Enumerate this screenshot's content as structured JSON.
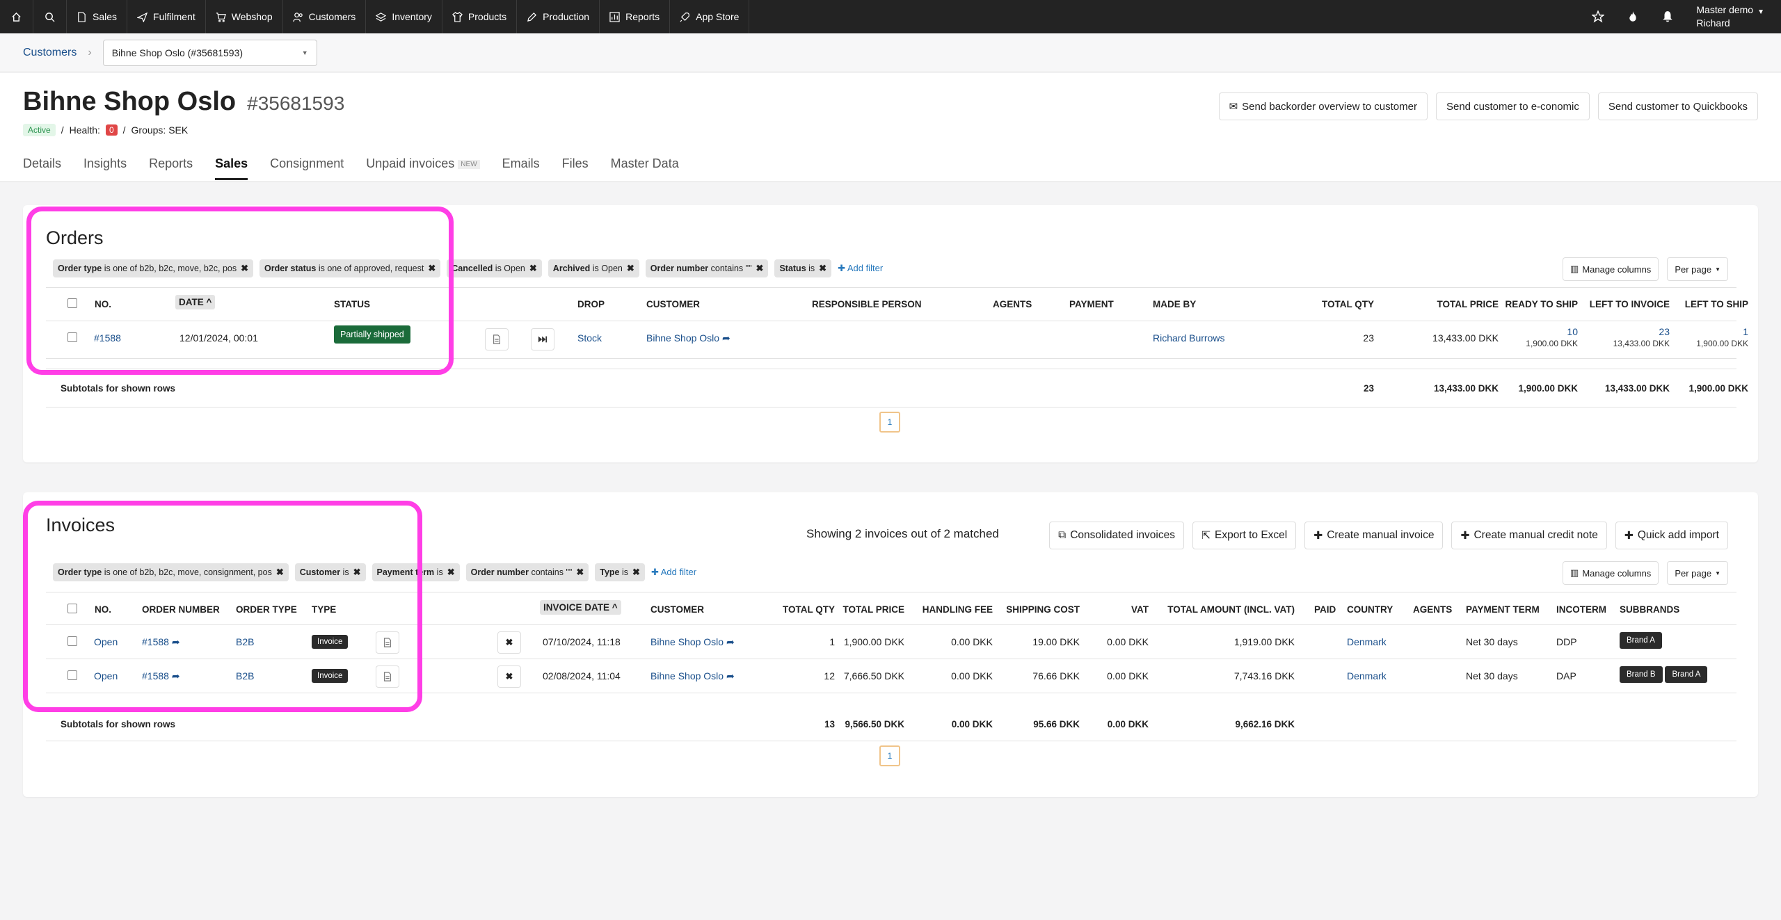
{
  "topnav": {
    "items": [
      "Sales",
      "Fulfilment",
      "Webshop",
      "Customers",
      "Inventory",
      "Products",
      "Production",
      "Reports",
      "App Store"
    ],
    "user_line1": "Master demo",
    "user_line2": "Richard"
  },
  "breadcrumb": {
    "root": "Customers",
    "selected": "Bihne Shop Oslo (#35681593)"
  },
  "customer": {
    "name": "Bihne Shop Oslo",
    "number": "#35681593",
    "status": "Active",
    "health_label": "Health:",
    "health_value": "0",
    "groups": "Groups: SEK"
  },
  "header_buttons": [
    "Send backorder overview to customer",
    "Send customer to e-conomic",
    "Send customer to Quickbooks"
  ],
  "tabs": [
    "Details",
    "Insights",
    "Reports",
    "Sales",
    "Consignment",
    "Unpaid invoices",
    "Emails",
    "Files",
    "Master Data"
  ],
  "tab_new_badge": "NEW",
  "orders": {
    "title": "Orders",
    "filters": [
      {
        "field": "Order type",
        "cond": "is one of b2b, b2c, move, b2c, pos"
      },
      {
        "field": "Order status",
        "cond": "is one of approved, request"
      },
      {
        "field": "Cancelled",
        "cond": "is Open"
      },
      {
        "field": "Archived",
        "cond": "is Open"
      },
      {
        "field": "Order number",
        "cond": "contains \"\""
      },
      {
        "field": "Status",
        "cond": "is"
      }
    ],
    "add_filter": "Add filter",
    "manage_columns": "Manage columns",
    "per_page": "Per page",
    "columns": [
      "NO.",
      "DATE",
      "STATUS",
      "DROP",
      "CUSTOMER",
      "RESPONSIBLE PERSON",
      "AGENTS",
      "PAYMENT",
      "MADE BY",
      "TOTAL QTY",
      "TOTAL PRICE",
      "READY TO SHIP",
      "LEFT TO INVOICE",
      "LEFT TO SHIP"
    ],
    "row": {
      "no": "#1588",
      "date": "12/01/2024, 00:01",
      "status": "Partially shipped",
      "drop": "Stock",
      "customer": "Bihne Shop Oslo",
      "made_by": "Richard Burrows",
      "total_qty": "23",
      "total_price": "13,433.00 DKK",
      "ready_to_ship": "10",
      "ready_to_ship_sub": "1,900.00 DKK",
      "left_to_invoice": "23",
      "left_to_invoice_sub": "13,433.00 DKK",
      "left_to_ship": "1",
      "left_to_ship_sub": "1,900.00 DKK"
    },
    "subtotal_label": "Subtotals for shown rows",
    "subtotals": {
      "qty": "23",
      "price": "13,433.00 DKK",
      "ready": "1,900.00 DKK",
      "left_inv": "13,433.00 DKK",
      "left_ship": "1,900.00 DKK"
    },
    "page": "1"
  },
  "invoices": {
    "title": "Invoices",
    "showing": "Showing 2 invoices out of 2 matched",
    "actions": [
      "Consolidated invoices",
      "Export to Excel",
      "Create manual invoice",
      "Create manual credit note",
      "Quick add import"
    ],
    "filters": [
      {
        "field": "Order type",
        "cond": "is one of b2b, b2c, move, consignment, pos"
      },
      {
        "field": "Customer",
        "cond": "is"
      },
      {
        "field": "Payment term",
        "cond": "is"
      },
      {
        "field": "Order number",
        "cond": "contains \"\""
      },
      {
        "field": "Type",
        "cond": "is"
      }
    ],
    "add_filter": "Add filter",
    "manage_columns": "Manage columns",
    "per_page": "Per page",
    "columns": [
      "NO.",
      "ORDER NUMBER",
      "ORDER TYPE",
      "TYPE",
      "INVOICE DATE",
      "CUSTOMER",
      "TOTAL QTY",
      "TOTAL PRICE",
      "HANDLING FEE",
      "SHIPPING COST",
      "VAT",
      "TOTAL AMOUNT (INCL. VAT)",
      "PAID",
      "COUNTRY",
      "AGENTS",
      "PAYMENT TERM",
      "INCOTERM",
      "SUBBRANDS"
    ],
    "rows": [
      {
        "no": "Open",
        "order": "#1588",
        "otype": "B2B",
        "type": "Invoice",
        "date": "07/10/2024, 11:18",
        "customer": "Bihne Shop Oslo",
        "qty": "1",
        "price": "1,900.00 DKK",
        "handling": "0.00 DKK",
        "shipping": "19.00 DKK",
        "vat": "0.00 DKK",
        "total": "1,919.00 DKK",
        "country": "Denmark",
        "term": "Net 30 days",
        "incoterm": "DDP",
        "brands": [
          "Brand A"
        ]
      },
      {
        "no": "Open",
        "order": "#1588",
        "otype": "B2B",
        "type": "Invoice",
        "date": "02/08/2024, 11:04",
        "customer": "Bihne Shop Oslo",
        "qty": "12",
        "price": "7,666.50 DKK",
        "handling": "0.00 DKK",
        "shipping": "76.66 DKK",
        "vat": "0.00 DKK",
        "total": "7,743.16 DKK",
        "country": "Denmark",
        "term": "Net 30 days",
        "incoterm": "DAP",
        "brands": [
          "Brand B",
          "Brand A"
        ]
      }
    ],
    "subtotal_label": "Subtotals for shown rows",
    "subtotals": {
      "qty": "13",
      "price": "9,566.50 DKK",
      "handling": "0.00 DKK",
      "shipping": "95.66 DKK",
      "vat": "0.00 DKK",
      "total": "9,662.16 DKK"
    },
    "page": "1"
  }
}
